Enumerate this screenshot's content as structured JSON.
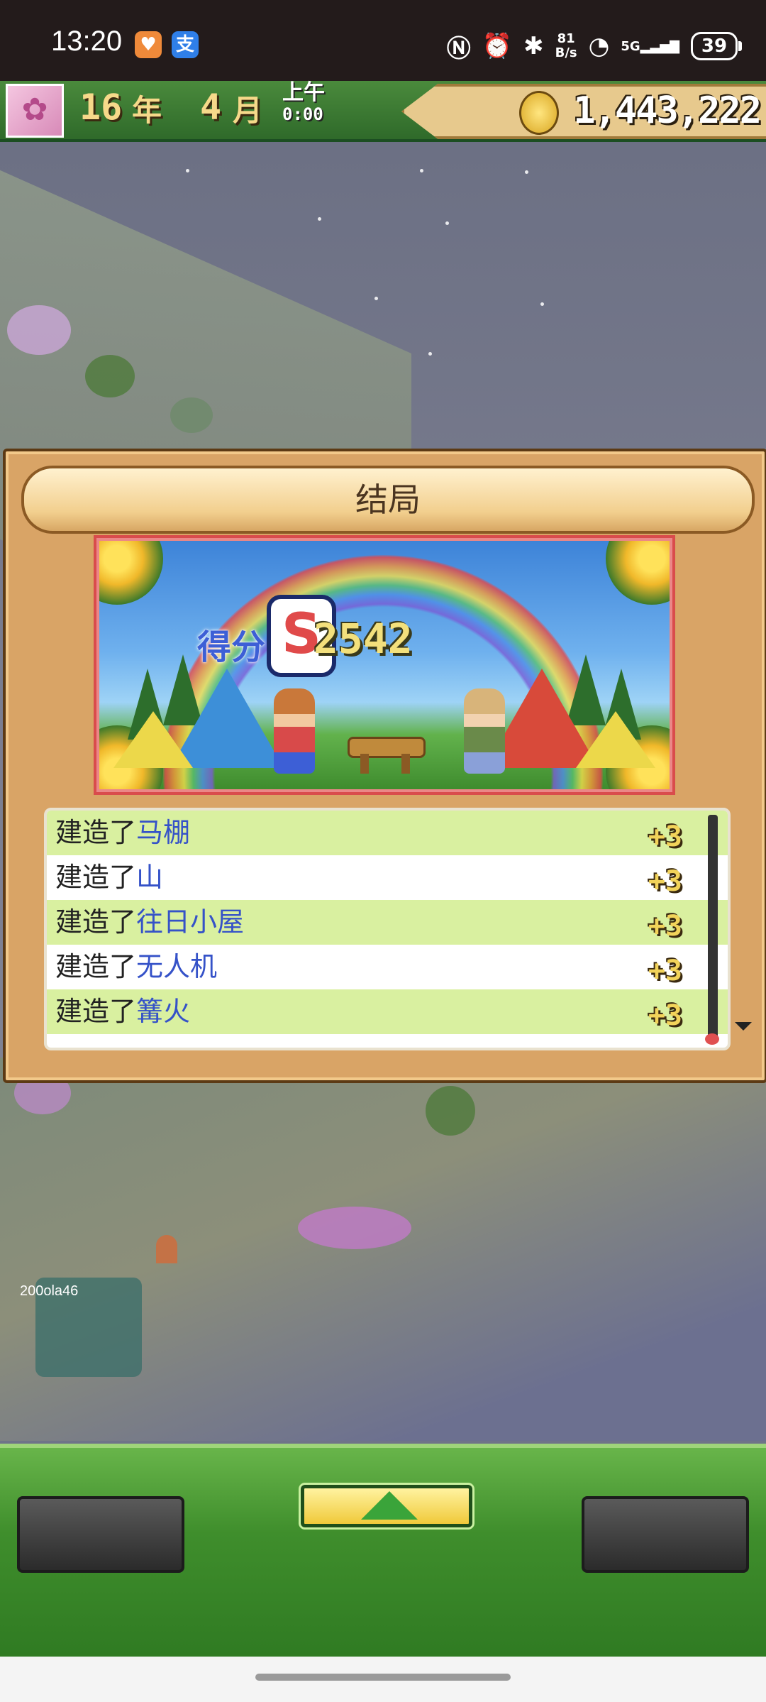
{
  "status_bar": {
    "time": "13:20",
    "app_icons": [
      "shield-app-icon",
      "alipay-icon"
    ],
    "alipay_glyph": "支",
    "system_icons": [
      "nfc-icon",
      "alarm-icon",
      "bluetooth-icon",
      "wifi-icon",
      "5g-signal-icon"
    ],
    "net_speed_value": "81",
    "net_speed_unit": "B/s",
    "network": "5G",
    "battery": "39"
  },
  "game_header": {
    "year": "16",
    "year_unit": "年",
    "month": "4",
    "month_unit": "月",
    "period": "上午",
    "clock": "0:00",
    "money": "1,443,222"
  },
  "dialog": {
    "title": "结局",
    "score_label": "得分",
    "rank": "S",
    "score": "2542",
    "events": [
      {
        "prefix": "建造了",
        "target": "马棚",
        "points": "+3"
      },
      {
        "prefix": "建造了",
        "target": "山",
        "points": "+3"
      },
      {
        "prefix": "建造了",
        "target": "往日小屋",
        "points": "+3"
      },
      {
        "prefix": "建造了",
        "target": "无人机",
        "points": "+3"
      },
      {
        "prefix": "建造了",
        "target": "篝火",
        "points": "+3"
      }
    ]
  },
  "watermark": "200ola46",
  "colors": {
    "accent_green": "#3f8e2c",
    "dialog_bg": "#d9a466",
    "event_target": "#3552c8",
    "row_highlight": "#d9f0a0"
  }
}
